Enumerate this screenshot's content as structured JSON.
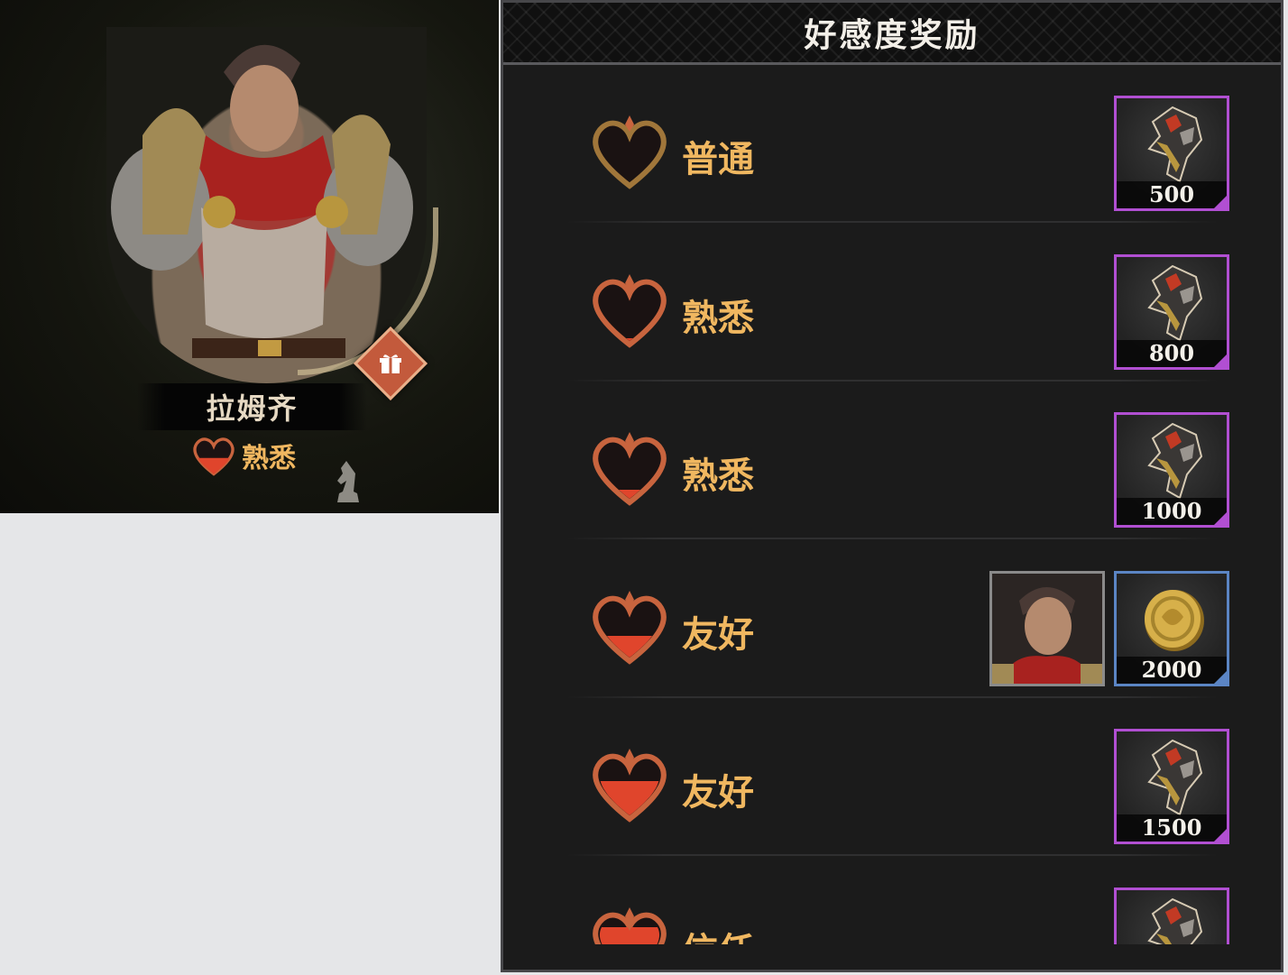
{
  "character": {
    "name": "拉姆齐",
    "affinity_level": "熟悉",
    "gift_icon": "gift-icon",
    "rank_icon": "chess-knight-icon"
  },
  "panel": {
    "title": "好感度奖励",
    "rewards": [
      {
        "tier": "普通",
        "heart_fill": 0,
        "items": [
          {
            "icon": "armor-fragment-icon",
            "qty": "500",
            "rarity": "purple"
          }
        ]
      },
      {
        "tier": "熟悉",
        "heart_fill": 0.1,
        "items": [
          {
            "icon": "armor-fragment-icon",
            "qty": "800",
            "rarity": "purple"
          }
        ]
      },
      {
        "tier": "熟悉",
        "heart_fill": 0.2,
        "items": [
          {
            "icon": "armor-fragment-icon",
            "qty": "1000",
            "rarity": "purple"
          }
        ]
      },
      {
        "tier": "友好",
        "heart_fill": 0.4,
        "items": [
          {
            "icon": "character-portrait-icon",
            "qty": "",
            "rarity": "grey"
          },
          {
            "icon": "gold-coin-icon",
            "qty": "2000",
            "rarity": "blue"
          }
        ]
      },
      {
        "tier": "友好",
        "heart_fill": 0.6,
        "items": [
          {
            "icon": "armor-fragment-icon",
            "qty": "1500",
            "rarity": "purple"
          }
        ]
      },
      {
        "tier": "信任",
        "heart_fill": 0.8,
        "items": [
          {
            "icon": "armor-fragment-icon",
            "qty": "",
            "rarity": "purple"
          }
        ]
      }
    ]
  },
  "colors": {
    "tier_text": "#f0b760",
    "heart_outline": "#c8643e",
    "heart_fill": "#e0452c",
    "purple_frame": "#b14fd2",
    "blue_frame": "#5b85c4"
  }
}
